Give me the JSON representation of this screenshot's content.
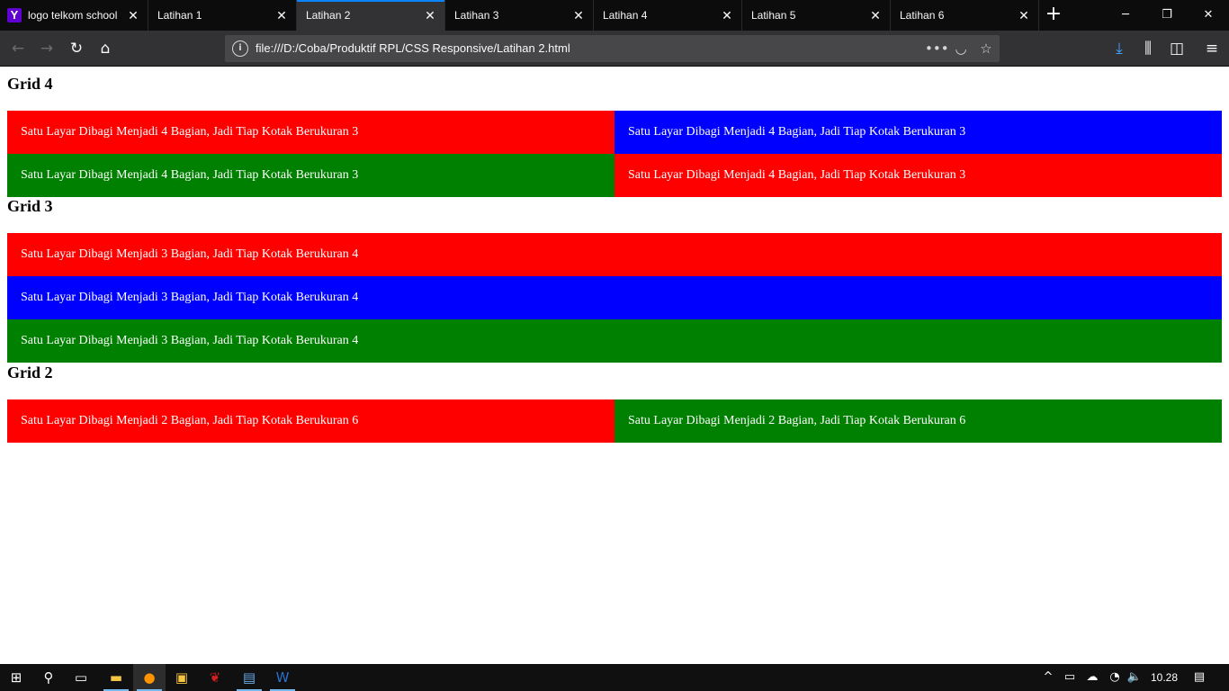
{
  "browser": {
    "tabs": [
      {
        "title": "logo telkom school",
        "favicon": "Y"
      },
      {
        "title": "Latihan 1"
      },
      {
        "title": "Latihan 2"
      },
      {
        "title": "Latihan 3"
      },
      {
        "title": "Latihan 4"
      },
      {
        "title": "Latihan 5"
      },
      {
        "title": "Latihan 6"
      }
    ],
    "active_tab_index": 2,
    "url": "file:///D:/Coba/Produktif RPL/CSS Responsive/Latihan 2.html",
    "colors": {
      "accent": "#0a84ff",
      "tabbar": "#0c0c0d",
      "toolbar": "#323234"
    }
  },
  "page": {
    "sections": [
      {
        "heading": "Grid 4",
        "cells": [
          {
            "text": "Satu Layar Dibagi Menjadi 4 Bagian, Jadi Tiap Kotak Berukuran 3",
            "color": "#ff0000"
          },
          {
            "text": "Satu Layar Dibagi Menjadi 4 Bagian, Jadi Tiap Kotak Berukuran 3",
            "color": "#0000ff"
          },
          {
            "text": "Satu Layar Dibagi Menjadi 4 Bagian, Jadi Tiap Kotak Berukuran 3",
            "color": "#008000"
          },
          {
            "text": "Satu Layar Dibagi Menjadi 4 Bagian, Jadi Tiap Kotak Berukuran 3",
            "color": "#ff0000"
          }
        ]
      },
      {
        "heading": "Grid 3",
        "cells": [
          {
            "text": "Satu Layar Dibagi Menjadi 3 Bagian, Jadi Tiap Kotak Berukuran 4",
            "color": "#ff0000"
          },
          {
            "text": "Satu Layar Dibagi Menjadi 3 Bagian, Jadi Tiap Kotak Berukuran 4",
            "color": "#0000ff"
          },
          {
            "text": "Satu Layar Dibagi Menjadi 3 Bagian, Jadi Tiap Kotak Berukuran 4",
            "color": "#008000"
          }
        ]
      },
      {
        "heading": "Grid 2",
        "cells": [
          {
            "text": "Satu Layar Dibagi Menjadi 2 Bagian, Jadi Tiap Kotak Berukuran 6",
            "color": "#ff0000"
          },
          {
            "text": "Satu Layar Dibagi Menjadi 2 Bagian, Jadi Tiap Kotak Berukuran 6",
            "color": "#008000"
          }
        ]
      }
    ]
  },
  "taskbar": {
    "clock": "10.28",
    "icons": [
      "windows-start-icon",
      "search-icon",
      "task-view-icon",
      "file-explorer-icon",
      "firefox-icon",
      "store-icon",
      "app-icon",
      "remote-desktop-icon",
      "word-icon"
    ]
  }
}
